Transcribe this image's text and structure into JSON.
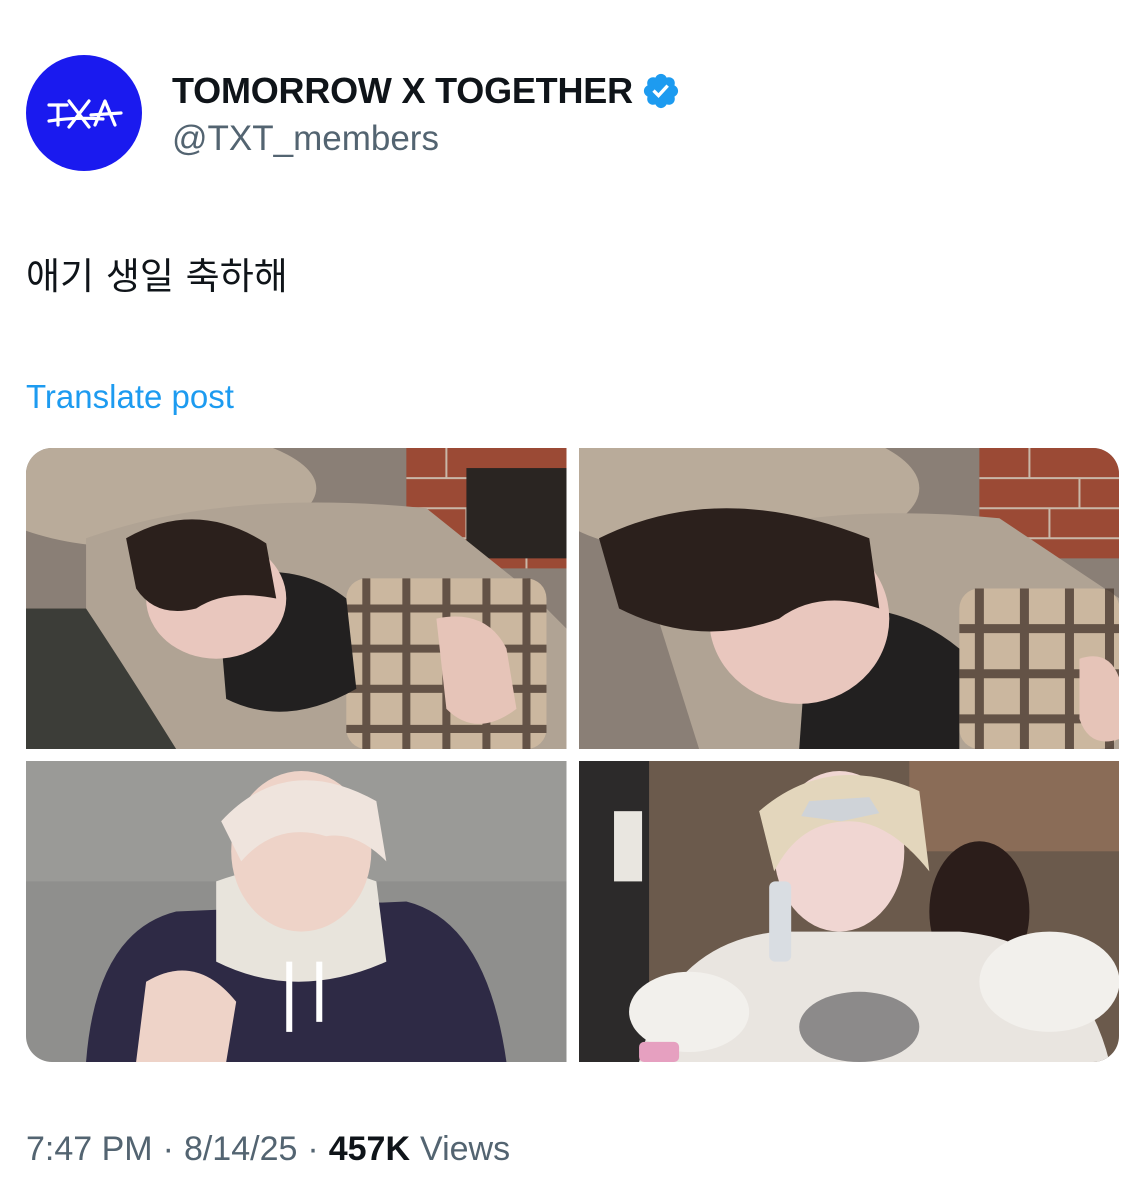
{
  "account": {
    "display_name": "TOMORROW X TOGETHER",
    "handle": "@TXT_members",
    "verified": true,
    "avatar_color": "#1a1aef",
    "logo_text": "TXT"
  },
  "post": {
    "text": "애기 생일 축하해",
    "translate_label": "Translate post"
  },
  "media": {
    "photos": [
      {
        "name": "photo-1-sleeping-on-sofa"
      },
      {
        "name": "photo-2-sleeping-closeup"
      },
      {
        "name": "photo-3-hoodie-portrait"
      },
      {
        "name": "photo-4-phone-call-stage-outfit"
      }
    ]
  },
  "meta": {
    "time": "7:47 PM",
    "separator": "·",
    "date": "8/14/25",
    "views_count": "457K",
    "views_label": "Views"
  },
  "colors": {
    "link": "#1d9bf0",
    "secondary_text": "#536471",
    "verified_badge": "#1d9bf0"
  },
  "icons": {
    "verified": "verified-badge-icon",
    "logo": "txt-logo-icon"
  }
}
